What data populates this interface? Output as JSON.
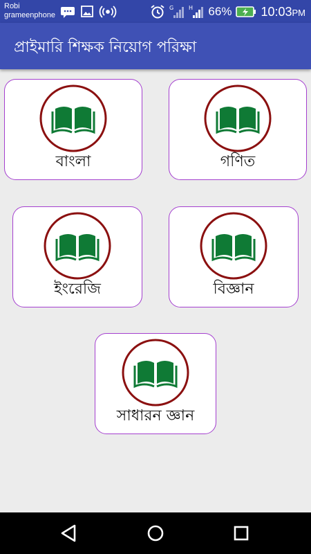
{
  "status_bar": {
    "carrier_line1": "Robi",
    "carrier_line2": "grameenphone",
    "battery_percent": "66%",
    "time": "10:03",
    "time_suffix": "PM",
    "icons": [
      "chat-icon",
      "image-icon",
      "hotspot-icon",
      "alarm-icon",
      "signal-g-icon",
      "signal-h-icon",
      "battery-charging-icon"
    ]
  },
  "app_bar": {
    "title": "প্রাইমারি শিক্ষক নিয়োগ পরিক্ষা"
  },
  "subjects": [
    {
      "label": "বাংলা",
      "icon": "book-icon"
    },
    {
      "label": "গণিত",
      "icon": "book-icon"
    },
    {
      "label": "ইংরেজি",
      "icon": "book-icon"
    },
    {
      "label": "বিজ্ঞান",
      "icon": "book-icon"
    },
    {
      "label": "সাধারন জ্ঞান",
      "icon": "book-icon"
    }
  ],
  "colors": {
    "status_bar": "#3346a8",
    "app_bar": "#3f51b5",
    "card_border": "#a43fcf",
    "icon_ring": "#8b1010",
    "book_green": "#0f7a35"
  },
  "nav_bar": {
    "buttons": [
      "back-icon",
      "home-icon",
      "recents-icon"
    ]
  }
}
